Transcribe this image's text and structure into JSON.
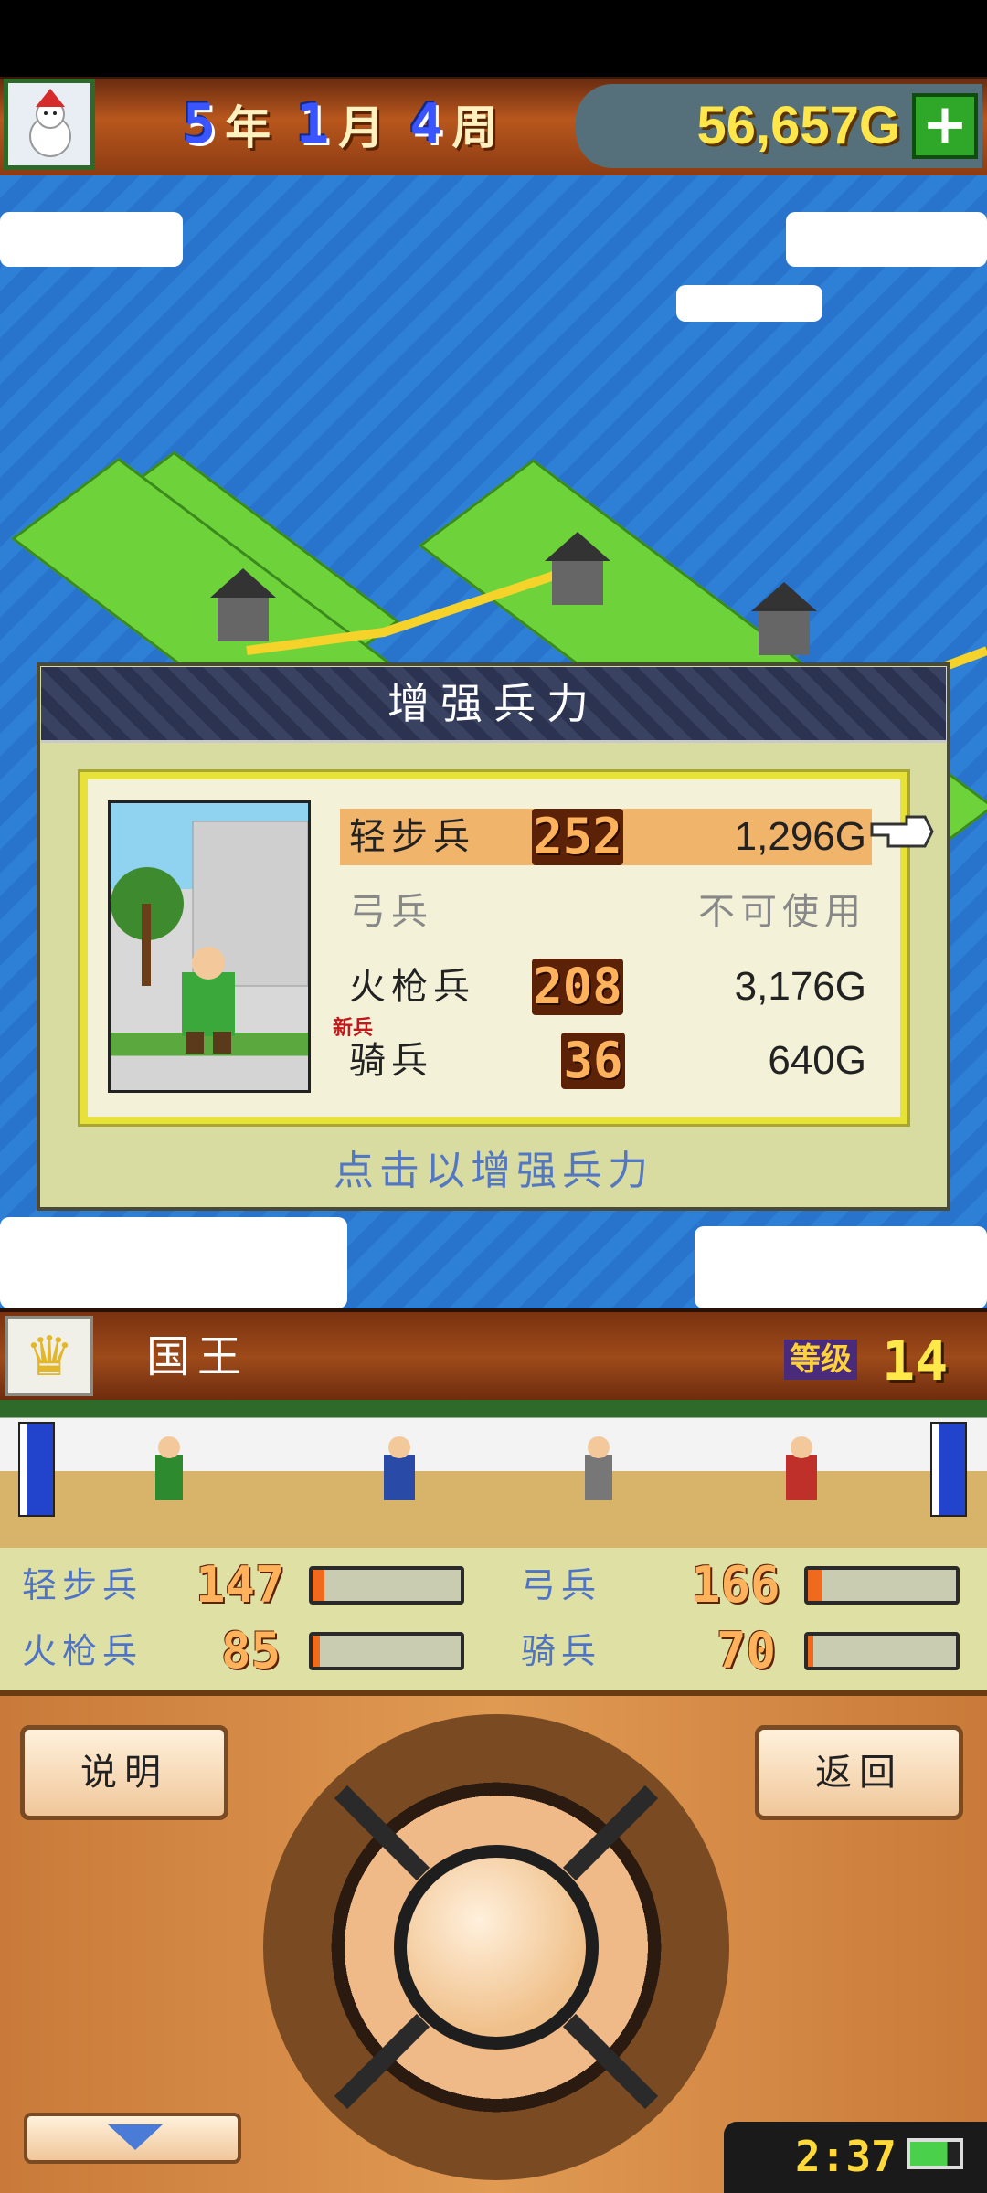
{
  "header": {
    "year_num": "5",
    "year_unit": "年",
    "month_num": "1",
    "month_unit": "月",
    "week_num": "4",
    "week_unit": "周",
    "money": "56,657G",
    "add_money_label": "+"
  },
  "dialog": {
    "title": "增强兵力",
    "rows": [
      {
        "name": "轻步兵",
        "count": "252",
        "price": "1,296G",
        "selected": true
      },
      {
        "name": "弓兵",
        "count": "",
        "price": "不可使用",
        "disabled": true
      },
      {
        "name": "火枪兵",
        "count": "208",
        "price": "3,176G"
      },
      {
        "name": "骑兵",
        "count": "36",
        "price": "640G",
        "badge": "新兵"
      }
    ],
    "hint": "点击以增强兵力"
  },
  "king": {
    "name": "国王",
    "level_label": "等级",
    "level_value": "14"
  },
  "troops": [
    {
      "name": "轻步兵",
      "value": "147",
      "fill": 0.08
    },
    {
      "name": "弓兵",
      "value": "166",
      "fill": 0.1
    },
    {
      "name": "火枪兵",
      "value": "85",
      "fill": 0.05
    },
    {
      "name": "骑兵",
      "value": "70",
      "fill": 0.04
    }
  ],
  "controls": {
    "help_label": "说明",
    "back_label": "返回"
  },
  "status": {
    "time": "2:37"
  },
  "colors": {
    "accent_blue": "#4f74c6",
    "money_yellow": "#ffe64a",
    "selected_row": "#f1b46b",
    "bar_fill": "#f06a1d"
  }
}
